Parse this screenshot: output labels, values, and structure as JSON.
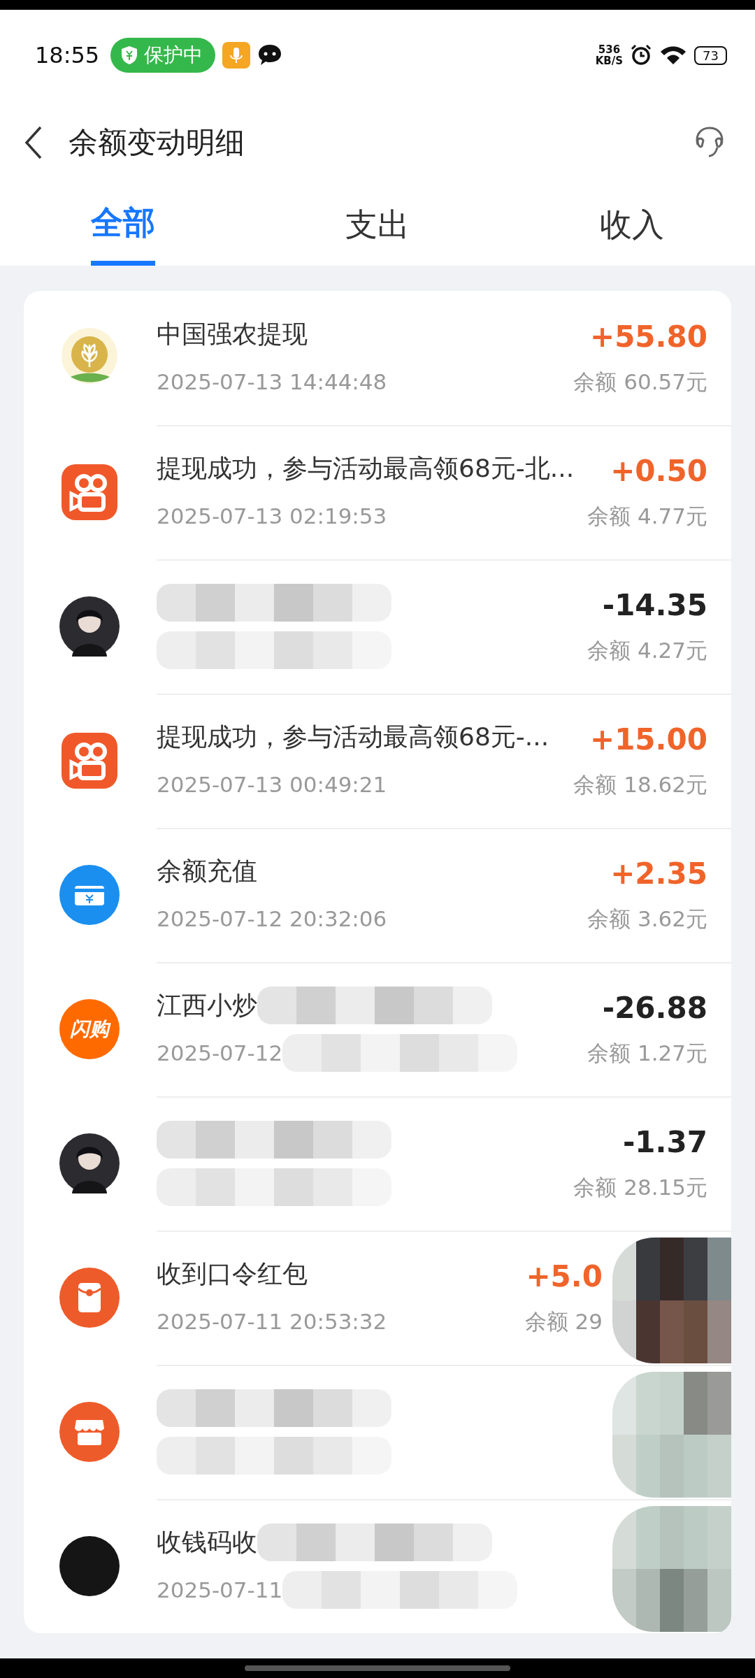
{
  "status_bar": {
    "time": "18:55",
    "protection_badge": "保护中",
    "network_speed": "536",
    "network_unit": "KB/S",
    "battery": "73"
  },
  "header": {
    "title": "余额变动明细"
  },
  "tabs": [
    {
      "label": "全部",
      "selected": true
    },
    {
      "label": "支出",
      "selected": false
    },
    {
      "label": "收入",
      "selected": false
    }
  ],
  "transactions": [
    {
      "kind": "wheat",
      "title": "中国强农提现",
      "time": "2025-07-13 14:44:48",
      "amount": {
        "text": "+55.80",
        "color": "#f0642a"
      },
      "balance": "余额 60.57元"
    },
    {
      "kind": "video",
      "title": "提现成功，参与活动最高领68元-北...",
      "time": "2025-07-13 02:19:53",
      "amount": {
        "text": "+0.50",
        "color": "#f0642a"
      },
      "balance": "余额 4.77元"
    },
    {
      "kind": "avatar",
      "title_masked": true,
      "time_masked": true,
      "amount": {
        "text": "-14.35",
        "color": "#222222"
      },
      "balance": "余额 4.27元"
    },
    {
      "kind": "video",
      "title": "提现成功，参与活动最高领68元-...",
      "time": "2025-07-13 00:49:21",
      "amount": {
        "text": "+15.00",
        "color": "#f0642a"
      },
      "balance": "余额 18.62元"
    },
    {
      "kind": "card",
      "title": "余额充值",
      "time": "2025-07-12 20:32:06",
      "amount": {
        "text": "+2.35",
        "color": "#f0642a"
      },
      "balance": "余额 3.62元"
    },
    {
      "kind": "flash",
      "icon_label": "闪购",
      "title": "江西小炒",
      "title_masked": true,
      "time": "2025-07-12",
      "time_masked": true,
      "amount": {
        "text": "-26.88",
        "color": "#222222"
      },
      "balance": "余额 1.27元"
    },
    {
      "kind": "avatar",
      "title_masked": true,
      "time_masked": true,
      "amount": {
        "text": "-1.37",
        "color": "#222222"
      },
      "balance": "余额 28.15元"
    },
    {
      "kind": "envelope",
      "title": "收到口令红包",
      "time": "2025-07-11 20:53:32",
      "amount": {
        "text": "+5.0",
        "color": "#f0642a"
      },
      "balance": "余额 29",
      "right_masked": true
    },
    {
      "kind": "shop",
      "title_masked": true,
      "time_masked": true,
      "right_masked": true
    },
    {
      "kind": "dot",
      "title": "收钱码收",
      "title_masked": true,
      "time": "2025-07-11",
      "time_masked": true,
      "right_masked": true
    }
  ]
}
